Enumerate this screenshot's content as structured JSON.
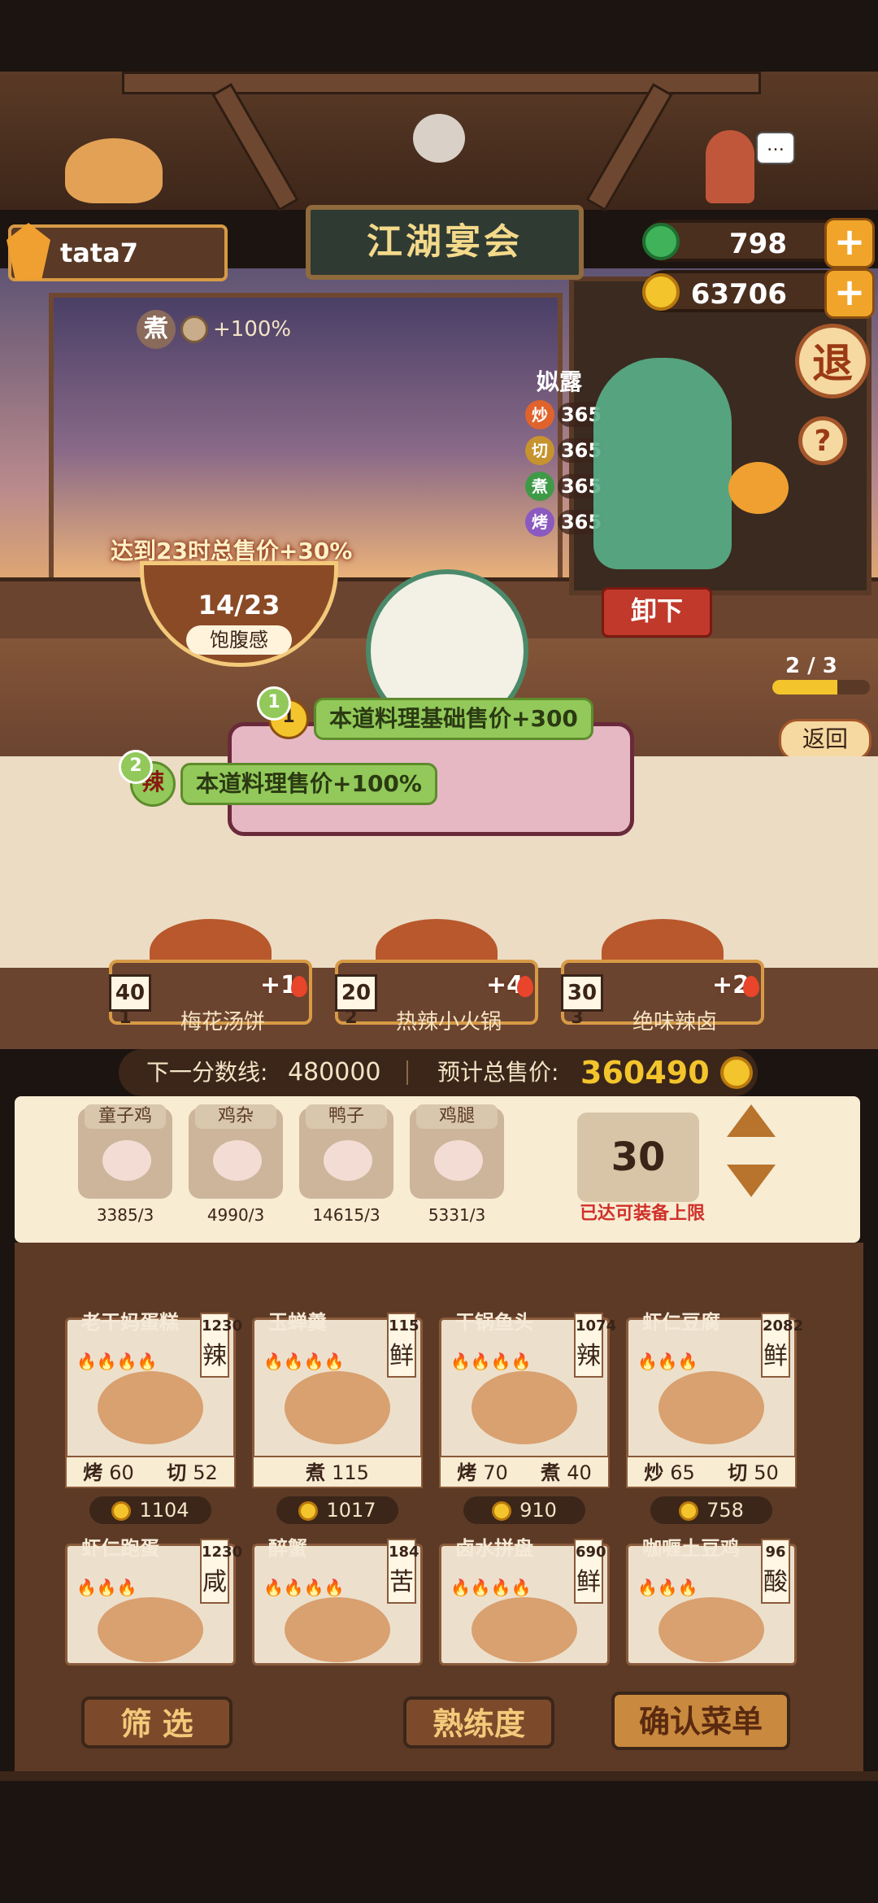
{
  "header": {
    "username": "tata7",
    "shop_sign": "江湖宴会",
    "jade": "798",
    "coins": "63706",
    "exit_label": "退",
    "help_label": "?"
  },
  "scene": {
    "cook_method": "煮",
    "cook_bonus": "+100%",
    "hour_bonus": "达到23时总售价+30%",
    "satiety_value": "14/23",
    "satiety_label": "饱腹感",
    "unload_label": "卸下",
    "progress": "2 / 3",
    "progress_fraction": 0.67,
    "back_label": "返回",
    "chef": {
      "name": "姒露",
      "stats": [
        {
          "icon": "炒",
          "value": "365",
          "color": "#e0632c"
        },
        {
          "icon": "切",
          "value": "365",
          "color": "#c7932e"
        },
        {
          "icon": "煮",
          "value": "365",
          "color": "#3f9a48"
        },
        {
          "icon": "烤",
          "value": "365",
          "color": "#8a5ac0"
        }
      ]
    },
    "buffs": [
      {
        "index": "1",
        "icon": "1",
        "text": "本道料理基础售价+300"
      },
      {
        "index": "2",
        "icon": "辣",
        "text": "本道料理售价+100%"
      }
    ]
  },
  "dishes": [
    {
      "count": "40",
      "bonus": "+1",
      "index": "1",
      "name": "梅花汤饼"
    },
    {
      "count": "20",
      "bonus": "+4",
      "index": "2",
      "name": "热辣小火锅"
    },
    {
      "count": "30",
      "bonus": "+2",
      "index": "3",
      "name": "绝味辣卤"
    }
  ],
  "score": {
    "next_label": "下一分数线:",
    "next_value": "480000",
    "total_label": "预计总售价:",
    "total_value": "360490"
  },
  "ingredients": [
    {
      "name": "童子鸡",
      "count": "3385/3"
    },
    {
      "name": "鸡杂",
      "count": "4990/3"
    },
    {
      "name": "鸭子",
      "count": "14615/3"
    },
    {
      "name": "鸡腿",
      "count": "5331/3"
    }
  ],
  "capacity": {
    "value": "30",
    "note": "已达可装备上限"
  },
  "menu": [
    {
      "name": "老干妈蛋糕",
      "fires": "🔥🔥🔥🔥",
      "score": "1230",
      "flavor": "辣",
      "skills": [
        {
          "k": "烤",
          "v": "60"
        },
        {
          "k": "切",
          "v": "52"
        }
      ],
      "price": "1104"
    },
    {
      "name": "玉蝉羹",
      "fires": "🔥🔥🔥🔥",
      "score": "115",
      "flavor": "鲜",
      "skills": [
        {
          "k": "煮",
          "v": "115"
        }
      ],
      "price": "1017"
    },
    {
      "name": "干锅鱼头",
      "fires": "🔥🔥🔥🔥",
      "score": "1074",
      "flavor": "辣",
      "skills": [
        {
          "k": "烤",
          "v": "70"
        },
        {
          "k": "煮",
          "v": "40"
        }
      ],
      "price": "910"
    },
    {
      "name": "虾仁豆腐",
      "fires": "🔥🔥🔥",
      "score": "2082",
      "flavor": "鲜",
      "skills": [
        {
          "k": "炒",
          "v": "65"
        },
        {
          "k": "切",
          "v": "50"
        }
      ],
      "price": "758"
    },
    {
      "name": "虾仁跑蛋",
      "fires": "🔥🔥🔥",
      "score": "1230",
      "flavor": "咸"
    },
    {
      "name": "醉蟹",
      "fires": "🔥🔥🔥🔥",
      "score": "184",
      "flavor": "苦"
    },
    {
      "name": "卤水拼盘",
      "fires": "🔥🔥🔥🔥",
      "score": "690",
      "flavor": "鲜"
    },
    {
      "name": "咖喱土豆鸡",
      "fires": "🔥🔥🔥",
      "score": "96",
      "flavor": "酸"
    }
  ],
  "buttons": {
    "filter": "筛 选",
    "proficiency": "熟练度",
    "confirm": "确认菜单"
  }
}
